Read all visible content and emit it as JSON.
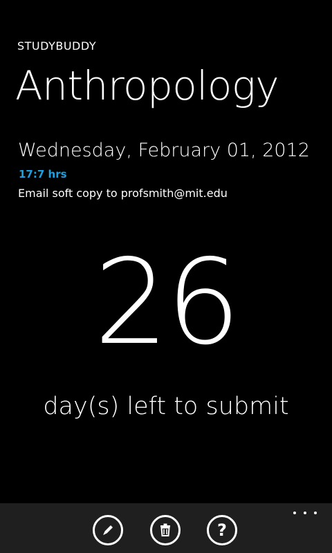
{
  "app": {
    "name": "STUDYBUDDY"
  },
  "assignment": {
    "subject": "Anthropology",
    "due_date": "Wednesday, February 01, 2012",
    "due_time": "17:7 hrs",
    "note": "Email soft copy to profsmith@mit.edu"
  },
  "countdown": {
    "days": "26",
    "label": "day(s) left to submit"
  },
  "app_bar": {
    "buttons": [
      {
        "icon": "edit-icon"
      },
      {
        "icon": "delete-icon"
      },
      {
        "icon": "help-icon",
        "glyph": "?"
      }
    ],
    "more_icon": "ellipsis-icon"
  },
  "colors": {
    "background": "#000000",
    "accent": "#1ba1e2",
    "text": "#ffffff",
    "app_bar": "#1f1f1f"
  }
}
